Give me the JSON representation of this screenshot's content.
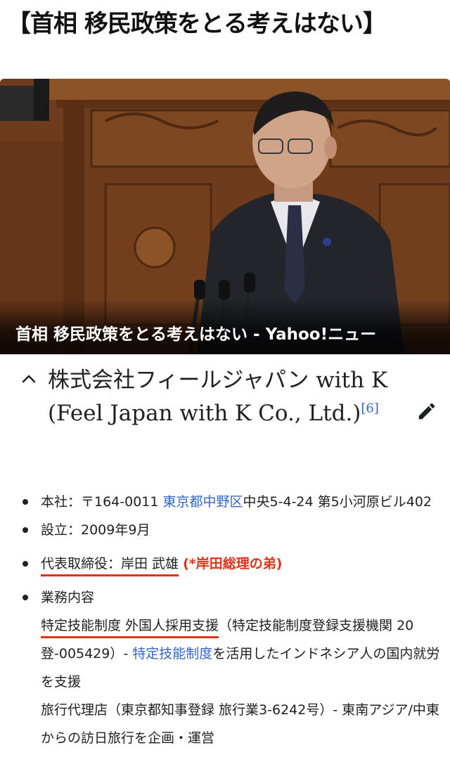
{
  "headline": "【首相 移民政策をとる考えはない】",
  "photo": {
    "caption": "首相 移民政策をとる考えはない - Yahoo!ニュー"
  },
  "section": {
    "chevron_icon": "chevron-up-icon",
    "title": "株式会社フィールジャパン with K　(Feel Japan with K Co., Ltd.)",
    "ref": "[6]",
    "edit_icon": "pencil-icon"
  },
  "info": {
    "hq_label": "本社：〒164-0011 ",
    "hq_link": "東京都中野区",
    "hq_rest": "中央5-4-24 第5小河原ビル402",
    "founded": "設立：2009年9月",
    "rep": "代表取締役：岸田 武雄",
    "rep_note": "(*岸田総理の弟)",
    "business_label": "業務内容",
    "business_main": "特定技能制度 外国人採用支援",
    "business_main_rest": "（特定技能制度登録支援機関 20登-005429）- ",
    "business_link": "特定技能制度",
    "business_tail": "を活用したインドネシア人の国内就労を支援",
    "travel": "旅行代理店（東京都知事登録 旅行業3-6242号）- 東南アジア/中東からの訪日旅行を企画・運営"
  },
  "colors": {
    "link": "#3366cc",
    "highlight": "#e53018"
  }
}
